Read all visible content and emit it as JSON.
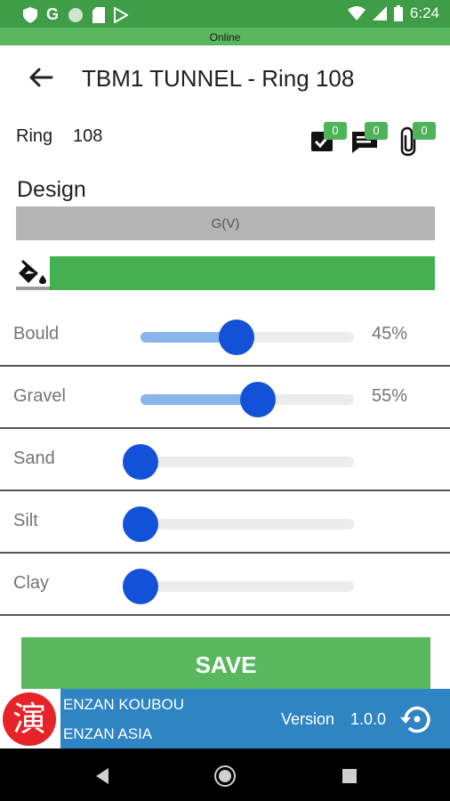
{
  "status_bar": {
    "time": "6:24",
    "left_icons": [
      "shield-icon",
      "google-icon",
      "circle-icon",
      "sim-icon",
      "play-store-icon"
    ],
    "right_icons": [
      "wifi-icon",
      "signal-icon",
      "battery-icon"
    ]
  },
  "connection": {
    "status": "Online"
  },
  "toolbar": {
    "title": "TBM1 TUNNEL - Ring 108",
    "back_icon": "arrow-back-icon"
  },
  "ring": {
    "label": "Ring",
    "value": "108",
    "checklist_count": "0",
    "comment_count": "0",
    "attachment_count": "0"
  },
  "design": {
    "label": "Design",
    "value": "G(V)"
  },
  "sliders": [
    {
      "label": "Bould",
      "percent": 45,
      "display": "45%"
    },
    {
      "label": "Gravel",
      "percent": 55,
      "display": "55%"
    },
    {
      "label": "Sand",
      "percent": 0,
      "display": ""
    },
    {
      "label": "Silt",
      "percent": 0,
      "display": ""
    },
    {
      "label": "Clay",
      "percent": 0,
      "display": ""
    }
  ],
  "save_label": "SAVE",
  "footer": {
    "logo_char": "演",
    "company_line1": "ENZAN KOUBOU",
    "company_line2": "ENZAN ASIA",
    "version_label": "Version",
    "version_value": "1.0.0"
  },
  "colors": {
    "status_bar": "#3f9d48",
    "online_bar": "#5bb75f",
    "fill_green": "#45b04f",
    "slider_thumb": "#1352d8",
    "slider_fill": "#8ab5ec",
    "save_button": "#59b85d",
    "footer": "#2f84c4",
    "logo": "#e7232a"
  }
}
